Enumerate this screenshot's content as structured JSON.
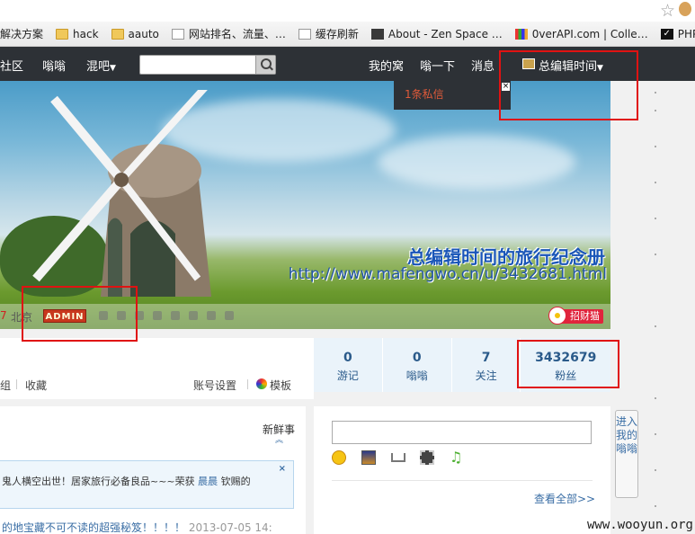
{
  "browser": {
    "bookmarks": [
      {
        "label": "解决方案",
        "icon": "none"
      },
      {
        "label": "hack",
        "icon": "folder-icon"
      },
      {
        "label": "aauto",
        "icon": "folder-icon"
      },
      {
        "label": "网站排名、流量、…",
        "icon": "page-icon"
      },
      {
        "label": "缓存刷新",
        "icon": "page-icon"
      },
      {
        "label": "About - Zen Space …",
        "icon": "zen-icon"
      },
      {
        "label": "0verAPI.com | Colle…",
        "icon": "overapi-icon"
      },
      {
        "label": "PHP之道",
        "icon": "check-icon"
      }
    ]
  },
  "nav": {
    "community": "社区",
    "weng": "嗡嗡",
    "hunba": "混吧",
    "search_placeholder": "",
    "my_nest": "我的窝",
    "weng_action": "嗡一下",
    "messages": "消息",
    "username": "总编辑时间",
    "dropdown_message": "1条私信",
    "close_glyph": "×"
  },
  "banner": {
    "title": "总编辑时间的旅行纪念册",
    "url": "http://www.mafengwo.cn/u/3432681.html",
    "level_number": "7",
    "city": "北京",
    "badge": "ADMIN",
    "zhaocaimao": "招财猫"
  },
  "tabs": {
    "left_partial": "组",
    "favorites": "收藏",
    "account_settings": "账号设置",
    "template": "模板"
  },
  "stats": [
    {
      "value": "0",
      "label": "游记"
    },
    {
      "value": "0",
      "label": "嗡嗡"
    },
    {
      "value": "7",
      "label": "关注"
    },
    {
      "value": "3432679",
      "label": "粉丝"
    }
  ],
  "feed": {
    "fresh": "新鲜事",
    "notice_line1": "鬼人横空出世！居家旅行必备良品~~~荣获",
    "notice_line1_user": "晨晨",
    "notice_line1_tail": "钦赐的",
    "notice_line2": "",
    "close": "×",
    "item_text": "的地宝藏不可不读的超强秘笈！！！！",
    "item_date": "2013-07-05 14:"
  },
  "poster": {
    "see_all": "查看全部>>"
  },
  "side_tab": "进入我的嗡嗡",
  "watermark": "www.wooyun.org"
}
